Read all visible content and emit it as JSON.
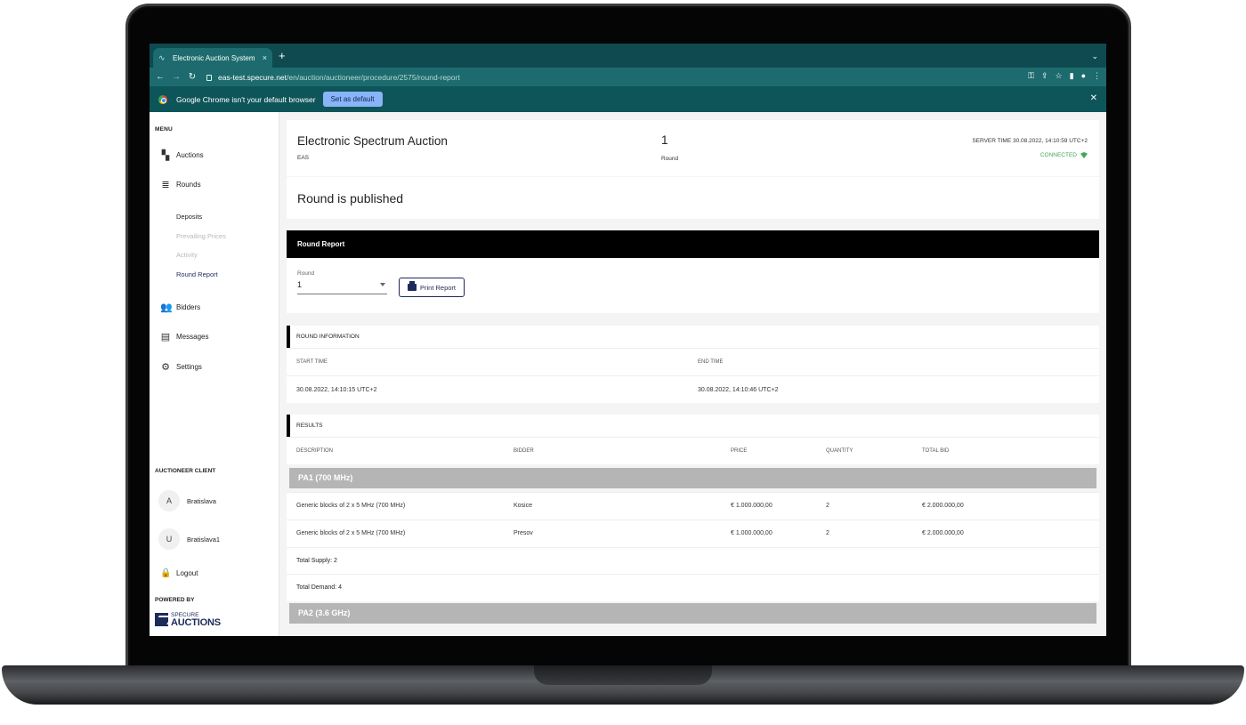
{
  "browser": {
    "tab_title": "Electronic Auction System",
    "tab_close": "×",
    "new_tab": "+",
    "tab_menu": "⌄",
    "back": "←",
    "forward": "→",
    "reload": "↻",
    "url_host": "eas-test.specure.net",
    "url_path": "/en/auction/auctioneer/procedure/2575/round-report",
    "infobar_text": "Google Chrome isn't your default browser",
    "set_default_label": "Set as default",
    "infobar_close": "✕"
  },
  "sidebar": {
    "menu_title": "MENU",
    "items": [
      {
        "label": "Auctions",
        "icon": "dashboard-icon"
      },
      {
        "label": "Rounds",
        "icon": "list-icon"
      },
      {
        "label": "Bidders",
        "icon": "people-icon"
      },
      {
        "label": "Messages",
        "icon": "message-icon"
      },
      {
        "label": "Settings",
        "icon": "gear-icon"
      }
    ],
    "sub_items": [
      {
        "label": "Deposits",
        "state": "enabled"
      },
      {
        "label": "Prevailing Prices",
        "state": "disabled"
      },
      {
        "label": "Activity",
        "state": "disabled"
      },
      {
        "label": "Round Report",
        "state": "active"
      }
    ],
    "client_title": "AUCTIONEER CLIENT",
    "clients": [
      {
        "initial": "A",
        "name": "Bratislava"
      },
      {
        "initial": "U",
        "name": "Bratislava1"
      }
    ],
    "logout_label": "Logout",
    "powered_by": "POWERED BY",
    "brand_line1": "SPECURE",
    "brand_line2": "AUCTIONS"
  },
  "header": {
    "auction_name": "Electronic Spectrum Auction",
    "auction_code": "EAS",
    "round_number": "1",
    "round_label": "Round",
    "server_time": "SERVER TIME 30.08.2022, 14:10:59 UTC+2",
    "connection_status": "CONNECTED"
  },
  "status": {
    "published_text": "Round is published"
  },
  "round_report": {
    "title": "Round Report",
    "round_field_label": "Round",
    "round_value": "1",
    "print_label": "Print Report"
  },
  "round_information": {
    "title": "ROUND INFORMATION",
    "start_label": "START TIME",
    "end_label": "END TIME",
    "start_value": "30.08.2022, 14:10:15 UTC+2",
    "end_value": "30.08.2022, 14:10:46 UTC+2"
  },
  "results": {
    "title": "RESULTS",
    "columns": [
      "DESCRIPTION",
      "BIDDER",
      "PRICE",
      "QUANTITY",
      "TOTAL BID"
    ],
    "groups": [
      {
        "name": "PA1 (700 MHz)",
        "rows": [
          {
            "description": "Generic blocks of 2 x 5 MHz (700 MHz)",
            "bidder": "Kosice",
            "price": "€ 1.000.000,00",
            "quantity": "2",
            "total": "€ 2.000.000,00"
          },
          {
            "description": "Generic blocks of 2 x 5 MHz (700 MHz)",
            "bidder": "Presov",
            "price": "€ 1.000.000,00",
            "quantity": "2",
            "total": "€ 2.000.000,00"
          }
        ],
        "total_supply": "Total Supply:  2",
        "total_demand": "Total Demand:  4"
      },
      {
        "name": "PA2 (3.6 GHz)"
      }
    ]
  },
  "colors": {
    "browser_dark": "#0e4a50",
    "browser_toolbar": "#1d6b6e",
    "accent_navy": "#1c2b5a",
    "connected_green": "#3fa854",
    "group_gray": "#b5b5b5"
  }
}
